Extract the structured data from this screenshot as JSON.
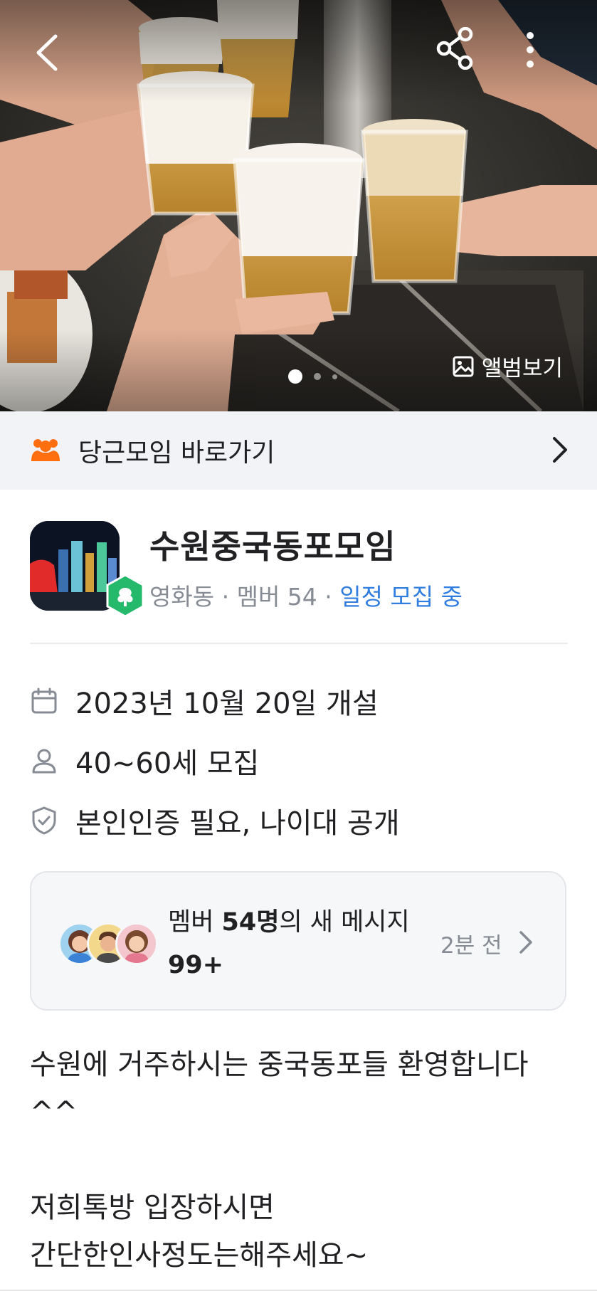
{
  "hero": {
    "album_label": "앨범보기",
    "slides_total": 3,
    "active_slide": 1
  },
  "shortcut": {
    "label": "당근모임 바로가기",
    "icon": "people-group-icon",
    "icon_color": "#ff6f0f"
  },
  "group": {
    "name": "수원중국동포모임",
    "location": "영화동",
    "members_label": "멤버 54",
    "status": "일정 모집 중",
    "status_color": "#2f7de1"
  },
  "info": [
    {
      "icon": "calendar-icon",
      "text": "2023년 10월 20일 개설"
    },
    {
      "icon": "person-icon",
      "text": "40~60세 모집"
    },
    {
      "icon": "shield-check-icon",
      "text": "본인인증 필요, 나이대 공개"
    }
  ],
  "chat": {
    "prefix": "멤버 ",
    "member_count": "54명",
    "middle": "의 새 메시지 ",
    "message_count": "99+",
    "time": "2분 전"
  },
  "description": [
    "수원에 거주하시는 중국동포들 환영합니다^^",
    "",
    "저희톡방 입장하시면",
    "간단한인사정도는해주세요~"
  ]
}
